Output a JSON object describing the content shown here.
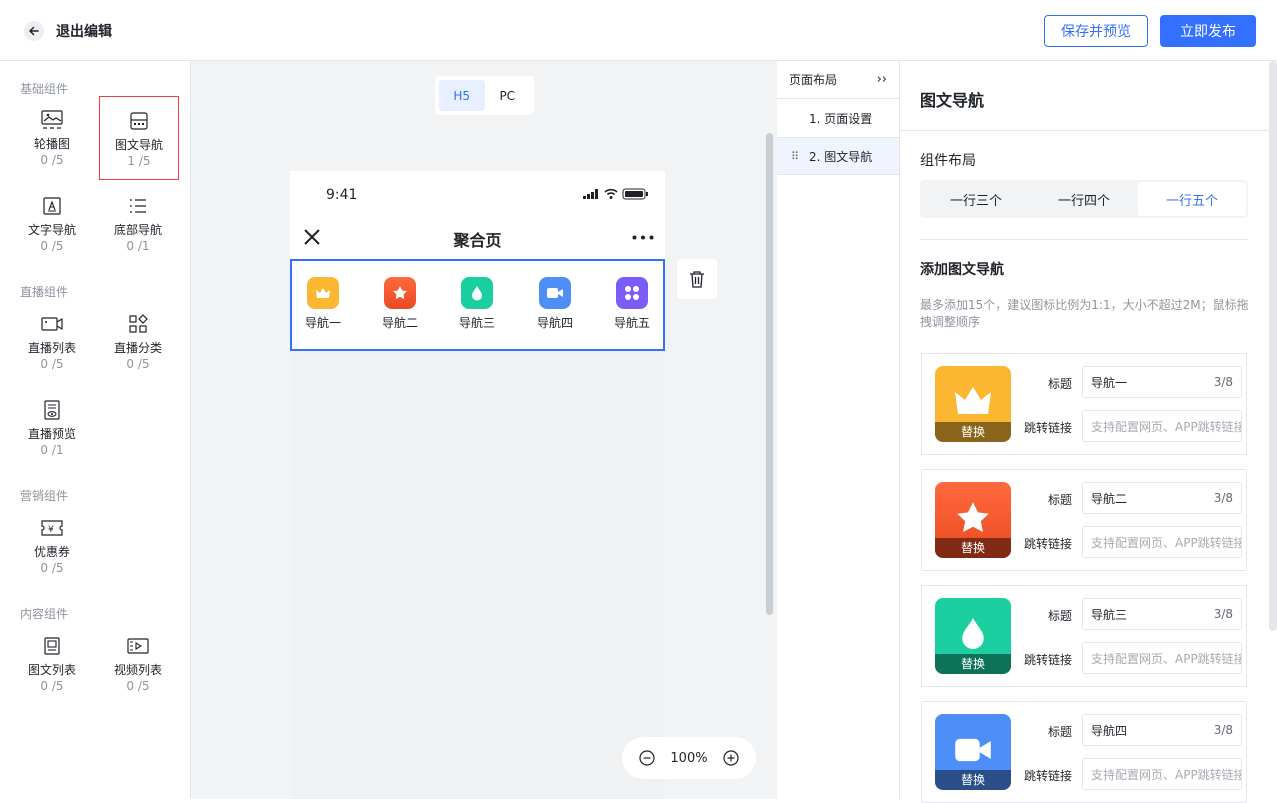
{
  "header": {
    "back_label": "退出编辑",
    "preview_label": "保存并预览",
    "publish_label": "立即发布"
  },
  "sidebar": {
    "groups": [
      {
        "title": "基础组件",
        "items": [
          {
            "name": "轮播图",
            "count": "0 /5"
          },
          {
            "name": "图文导航",
            "count": "1 /5"
          },
          {
            "name": "文字导航",
            "count": "0 /5"
          },
          {
            "name": "底部导航",
            "count": "0 /1"
          }
        ]
      },
      {
        "title": "直播组件",
        "items": [
          {
            "name": "直播列表",
            "count": "0 /5"
          },
          {
            "name": "直播分类",
            "count": "0 /5"
          },
          {
            "name": "直播预览",
            "count": "0 /1"
          }
        ]
      },
      {
        "title": "营销组件",
        "items": [
          {
            "name": "优惠券",
            "count": "0 /5"
          }
        ]
      },
      {
        "title": "内容组件",
        "items": [
          {
            "name": "图文列表",
            "count": "0 /5"
          },
          {
            "name": "视频列表",
            "count": "0 /5"
          }
        ]
      }
    ]
  },
  "canvas": {
    "device_tabs": [
      "H5",
      "PC"
    ],
    "active_tab": "H5",
    "phone": {
      "time": "9:41",
      "title": "聚合页",
      "nav_items": [
        {
          "label": "导航一",
          "color": "#fbb731"
        },
        {
          "label": "导航二",
          "color": "#f2552c"
        },
        {
          "label": "导航三",
          "color": "#1bcfa0"
        },
        {
          "label": "导航四",
          "color": "#4e8ef7"
        },
        {
          "label": "导航五",
          "color": "#7b5cf5"
        }
      ]
    },
    "zoom": "100%"
  },
  "tree": {
    "title": "页面布局",
    "items": [
      "1. 页面设置",
      "2. 图文导航"
    ]
  },
  "panel": {
    "title": "图文导航",
    "layout_label": "组件布局",
    "layout_options": [
      "一行三个",
      "一行四个",
      "一行五个"
    ],
    "layout_selected": "一行五个",
    "add_title": "添加图文导航",
    "hint": "最多添加15个，建议图标比例为1:1，大小不超过2M；鼠标拖拽调整顺序",
    "cards": [
      {
        "title": "导航一",
        "count": "3/8",
        "replace": "替换",
        "icon": "crown-icon"
      },
      {
        "title": "导航二",
        "count": "3/8",
        "replace": "替换",
        "icon": "star-icon"
      },
      {
        "title": "导航三",
        "count": "3/8",
        "replace": "替换",
        "icon": "drop-icon"
      },
      {
        "title": "导航四",
        "count": "3/8",
        "replace": "替换",
        "icon": "video-icon"
      }
    ],
    "title_label": "标题",
    "link_label": "跳转链接",
    "link_placeholder": "支持配置网页、APP跳转链接"
  }
}
